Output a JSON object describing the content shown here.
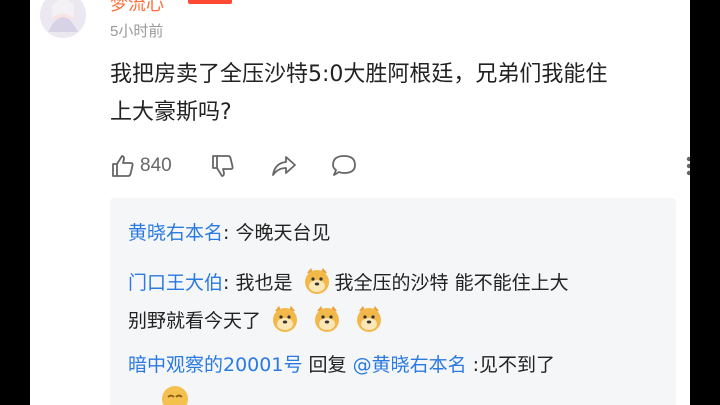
{
  "comment": {
    "username": "梦流心",
    "level_badge": "",
    "time": "5小时前",
    "text_line1": "我把房卖了全压沙特5:0大胜阿根廷，兄弟们我能住",
    "text_line2": "上大豪斯吗?",
    "like_count": "840"
  },
  "replies": [
    {
      "name": "黄晓右本名",
      "sep": ": ",
      "text": "今晚天台见"
    },
    {
      "name": "门口王大伯",
      "sep": ": ",
      "text_a": "我也是",
      "emoji_a": "doge-emoji",
      "text_b": "我全压的沙特 能不能住上大",
      "text_c": "别野就看今天了",
      "emoji_c": "doge-emoji"
    },
    {
      "name": "暗中观察的20001号",
      "reply_word": "回复",
      "mention": "@黄晓右本名",
      "text": ":见不到了"
    }
  ],
  "colors": {
    "name_blue": "#2a7ae2",
    "username_orange": "#ff6d3a",
    "badge_red": "#ff4b33"
  }
}
